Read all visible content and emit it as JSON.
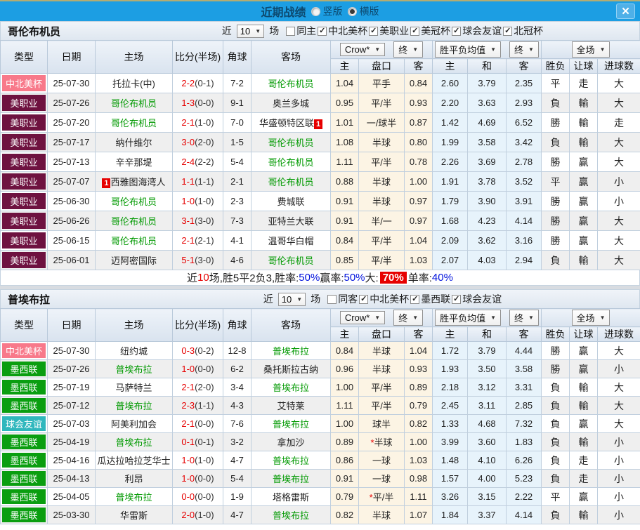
{
  "icons": {
    "close": "✕",
    "dropdown_arrow": "▼",
    "check": "✓"
  },
  "colors": {
    "accent_blue": "#1c9ee3",
    "win_red": "#e60000",
    "lose_green": "#008800",
    "draw_blue": "#0012dd",
    "type": {
      "中北美杯": "#f8798a",
      "美职业": "#6e1240",
      "墨西联": "#0a9e10",
      "球会友谊": "#2fb7bd"
    }
  },
  "titlebar": {
    "title": "近期战绩",
    "radio_vertical": "竖版",
    "radio_horizontal": "横版",
    "selected": "横版"
  },
  "table_header": {
    "cols": [
      "类型",
      "日期",
      "主场",
      "比分(半场)",
      "角球",
      "客场"
    ],
    "sub": [
      "主",
      "盘口",
      "客",
      "主",
      "和",
      "客",
      "胜负",
      "让球",
      "进球数"
    ],
    "dd_company": "Crow*",
    "dd_final": "终",
    "dd_avg": "胜平负均值",
    "dd_final2": "终",
    "dd_scope": "全场"
  },
  "sections": [
    {
      "team": "哥伦布机员",
      "filter": {
        "prefix": "近",
        "count": "10",
        "suffix": "场",
        "same": "同主",
        "leagues": [
          "中北美杯",
          "美职业",
          "美冠杯",
          "球会友谊",
          "北冠杯"
        ]
      },
      "rows": [
        {
          "type": "中北美杯",
          "date": "25-07-30",
          "home": "托拉卡(中)",
          "home_green": false,
          "home_badge": null,
          "ft": "2-2",
          "ht": "(0-1)",
          "corner": "7-2",
          "away": "哥伦布机员",
          "away_green": true,
          "away_badge": null,
          "odds": [
            "1.04",
            "平手",
            "0.84"
          ],
          "avg": [
            "2.60",
            "3.79",
            "2.35"
          ],
          "res": [
            "平",
            "走",
            "大"
          ],
          "rc": [
            "b",
            "b",
            "r"
          ]
        },
        {
          "type": "美职业",
          "date": "25-07-26",
          "home": "哥伦布机员",
          "home_green": true,
          "home_badge": null,
          "ft": "1-3",
          "ht": "(0-0)",
          "corner": "9-1",
          "away": "奥兰多城",
          "away_green": false,
          "away_badge": null,
          "odds": [
            "0.95",
            "平/半",
            "0.93"
          ],
          "avg": [
            "2.20",
            "3.63",
            "2.93"
          ],
          "res": [
            "負",
            "輸",
            "大"
          ],
          "rc": [
            "g",
            "g",
            "r"
          ]
        },
        {
          "type": "美职业",
          "date": "25-07-20",
          "home": "哥伦布机员",
          "home_green": true,
          "home_badge": null,
          "ft": "2-1",
          "ht": "(1-0)",
          "corner": "7-0",
          "away": "华盛顿特区联",
          "away_green": false,
          "away_badge": "1",
          "odds": [
            "1.01",
            "一/球半",
            "0.87"
          ],
          "avg": [
            "1.42",
            "4.69",
            "6.52"
          ],
          "res": [
            "勝",
            "輸",
            "走"
          ],
          "rc": [
            "r",
            "g",
            "b"
          ]
        },
        {
          "type": "美职业",
          "date": "25-07-17",
          "home": "纳什维尔",
          "home_green": false,
          "home_badge": null,
          "ft": "3-0",
          "ht": "(2-0)",
          "corner": "1-5",
          "away": "哥伦布机员",
          "away_green": true,
          "away_badge": null,
          "odds": [
            "1.08",
            "半球",
            "0.80"
          ],
          "avg": [
            "1.99",
            "3.58",
            "3.42"
          ],
          "res": [
            "負",
            "輸",
            "大"
          ],
          "rc": [
            "g",
            "g",
            "r"
          ]
        },
        {
          "type": "美职业",
          "date": "25-07-13",
          "home": "辛辛那堤",
          "home_green": false,
          "home_badge": null,
          "ft": "2-4",
          "ht": "(2-2)",
          "corner": "5-4",
          "away": "哥伦布机员",
          "away_green": true,
          "away_badge": null,
          "odds": [
            "1.11",
            "平/半",
            "0.78"
          ],
          "avg": [
            "2.26",
            "3.69",
            "2.78"
          ],
          "res": [
            "勝",
            "贏",
            "大"
          ],
          "rc": [
            "r",
            "r",
            "r"
          ]
        },
        {
          "type": "美职业",
          "date": "25-07-07",
          "home": "西雅图海湾人",
          "home_green": false,
          "home_badge": "1",
          "ft": "1-1",
          "ht": "(1-1)",
          "corner": "2-1",
          "away": "哥伦布机员",
          "away_green": true,
          "away_badge": null,
          "odds": [
            "0.88",
            "半球",
            "1.00"
          ],
          "avg": [
            "1.91",
            "3.78",
            "3.52"
          ],
          "res": [
            "平",
            "贏",
            "小"
          ],
          "rc": [
            "b",
            "r",
            "g"
          ]
        },
        {
          "type": "美职业",
          "date": "25-06-30",
          "home": "哥伦布机员",
          "home_green": true,
          "home_badge": null,
          "ft": "1-0",
          "ht": "(1-0)",
          "corner": "2-3",
          "away": "费城联",
          "away_green": false,
          "away_badge": null,
          "odds": [
            "0.91",
            "半球",
            "0.97"
          ],
          "avg": [
            "1.79",
            "3.90",
            "3.91"
          ],
          "res": [
            "勝",
            "贏",
            "小"
          ],
          "rc": [
            "r",
            "r",
            "g"
          ]
        },
        {
          "type": "美职业",
          "date": "25-06-26",
          "home": "哥伦布机员",
          "home_green": true,
          "home_badge": null,
          "ft": "3-1",
          "ht": "(3-0)",
          "corner": "7-3",
          "away": "亚特兰大联",
          "away_green": false,
          "away_badge": null,
          "odds": [
            "0.91",
            "半/一",
            "0.97"
          ],
          "avg": [
            "1.68",
            "4.23",
            "4.14"
          ],
          "res": [
            "勝",
            "贏",
            "大"
          ],
          "rc": [
            "r",
            "r",
            "r"
          ]
        },
        {
          "type": "美职业",
          "date": "25-06-15",
          "home": "哥伦布机员",
          "home_green": true,
          "home_badge": null,
          "ft": "2-1",
          "ht": "(2-1)",
          "corner": "4-1",
          "away": "温哥华白帽",
          "away_green": false,
          "away_badge": null,
          "odds": [
            "0.84",
            "平/半",
            "1.04"
          ],
          "avg": [
            "2.09",
            "3.62",
            "3.16"
          ],
          "res": [
            "勝",
            "贏",
            "大"
          ],
          "rc": [
            "r",
            "r",
            "r"
          ]
        },
        {
          "type": "美职业",
          "date": "25-06-01",
          "home": "迈阿密国际",
          "home_green": false,
          "home_badge": null,
          "ft": "5-1",
          "ht": "(3-0)",
          "corner": "4-6",
          "away": "哥伦布机员",
          "away_green": true,
          "away_badge": null,
          "odds": [
            "0.85",
            "平/半",
            "1.03"
          ],
          "avg": [
            "2.07",
            "4.03",
            "2.94"
          ],
          "res": [
            "負",
            "輸",
            "大"
          ],
          "rc": [
            "g",
            "g",
            "r"
          ]
        }
      ],
      "summary": [
        [
          "近",
          "k"
        ],
        [
          "10",
          "r"
        ],
        [
          "场,胜5平2负3, ",
          "k"
        ],
        [
          "胜率:",
          "k"
        ],
        [
          "50%",
          "b"
        ],
        [
          " 赢率:",
          "k"
        ],
        [
          "50%",
          "b"
        ],
        [
          " 大:",
          "k"
        ],
        [
          "70%",
          "hl"
        ],
        [
          " 单率:",
          "k"
        ],
        [
          "40%",
          "b"
        ]
      ]
    },
    {
      "team": "普埃布拉",
      "filter": {
        "prefix": "近",
        "count": "10",
        "suffix": "场",
        "same": "同客",
        "leagues": [
          "中北美杯",
          "墨西联",
          "球会友谊"
        ]
      },
      "rows": [
        {
          "type": "中北美杯",
          "date": "25-07-30",
          "home": "纽约城",
          "home_green": false,
          "home_badge": null,
          "ft": "0-3",
          "ht": "(0-2)",
          "corner": "12-8",
          "away": "普埃布拉",
          "away_green": true,
          "away_badge": null,
          "odds": [
            "0.84",
            "半球",
            "1.04"
          ],
          "avg": [
            "1.72",
            "3.79",
            "4.44"
          ],
          "res": [
            "勝",
            "贏",
            "大"
          ],
          "rc": [
            "r",
            "r",
            "r"
          ]
        },
        {
          "type": "墨西联",
          "date": "25-07-26",
          "home": "普埃布拉",
          "home_green": true,
          "home_badge": null,
          "ft": "1-0",
          "ht": "(0-0)",
          "corner": "6-2",
          "away": "桑托斯拉古纳",
          "away_green": false,
          "away_badge": null,
          "odds": [
            "0.96",
            "半球",
            "0.93"
          ],
          "avg": [
            "1.93",
            "3.50",
            "3.58"
          ],
          "res": [
            "勝",
            "贏",
            "小"
          ],
          "rc": [
            "r",
            "r",
            "g"
          ]
        },
        {
          "type": "墨西联",
          "date": "25-07-19",
          "home": "马萨特兰",
          "home_green": false,
          "home_badge": null,
          "ft": "2-1",
          "ht": "(2-0)",
          "corner": "3-4",
          "away": "普埃布拉",
          "away_green": true,
          "away_badge": null,
          "odds": [
            "1.00",
            "平/半",
            "0.89"
          ],
          "avg": [
            "2.18",
            "3.12",
            "3.31"
          ],
          "res": [
            "負",
            "輸",
            "大"
          ],
          "rc": [
            "g",
            "g",
            "r"
          ]
        },
        {
          "type": "墨西联",
          "date": "25-07-12",
          "home": "普埃布拉",
          "home_green": true,
          "home_badge": null,
          "ft": "2-3",
          "ht": "(1-1)",
          "corner": "4-3",
          "away": "艾特莱",
          "away_green": false,
          "away_badge": null,
          "odds": [
            "1.11",
            "平/半",
            "0.79"
          ],
          "avg": [
            "2.45",
            "3.11",
            "2.85"
          ],
          "res": [
            "負",
            "輸",
            "大"
          ],
          "rc": [
            "g",
            "g",
            "r"
          ]
        },
        {
          "type": "球会友谊",
          "date": "25-07-03",
          "home": "阿美利加会",
          "home_green": false,
          "home_badge": null,
          "ft": "2-1",
          "ht": "(0-0)",
          "corner": "7-6",
          "away": "普埃布拉",
          "away_green": true,
          "away_badge": null,
          "odds": [
            "1.00",
            "球半",
            "0.82"
          ],
          "avg": [
            "1.33",
            "4.68",
            "7.32"
          ],
          "res": [
            "負",
            "贏",
            "大"
          ],
          "rc": [
            "g",
            "r",
            "r"
          ]
        },
        {
          "type": "墨西联",
          "date": "25-04-19",
          "home": "普埃布拉",
          "home_green": true,
          "home_badge": null,
          "ft": "0-1",
          "ht": "(0-1)",
          "corner": "3-2",
          "away": "拿加沙",
          "away_green": false,
          "away_badge": null,
          "odds": [
            "0.89",
            "*半球",
            "1.00"
          ],
          "avg": [
            "3.99",
            "3.60",
            "1.83"
          ],
          "res": [
            "負",
            "輸",
            "小"
          ],
          "rc": [
            "g",
            "g",
            "g"
          ]
        },
        {
          "type": "墨西联",
          "date": "25-04-16",
          "home": "瓜达拉哈拉芝华士",
          "home_green": false,
          "home_badge": null,
          "ft": "1-0",
          "ht": "(1-0)",
          "corner": "4-7",
          "away": "普埃布拉",
          "away_green": true,
          "away_badge": null,
          "odds": [
            "0.86",
            "一球",
            "1.03"
          ],
          "avg": [
            "1.48",
            "4.10",
            "6.26"
          ],
          "res": [
            "負",
            "走",
            "小"
          ],
          "rc": [
            "g",
            "b",
            "g"
          ]
        },
        {
          "type": "墨西联",
          "date": "25-04-13",
          "home": "利昂",
          "home_green": false,
          "home_badge": null,
          "ft": "1-0",
          "ht": "(0-0)",
          "corner": "5-4",
          "away": "普埃布拉",
          "away_green": true,
          "away_badge": null,
          "odds": [
            "0.91",
            "一球",
            "0.98"
          ],
          "avg": [
            "1.57",
            "4.00",
            "5.23"
          ],
          "res": [
            "負",
            "走",
            "小"
          ],
          "rc": [
            "g",
            "b",
            "g"
          ]
        },
        {
          "type": "墨西联",
          "date": "25-04-05",
          "home": "普埃布拉",
          "home_green": true,
          "home_badge": null,
          "ft": "0-0",
          "ht": "(0-0)",
          "corner": "1-9",
          "away": "塔格雷斯",
          "away_green": false,
          "away_badge": null,
          "odds": [
            "0.79",
            "*平/半",
            "1.11"
          ],
          "avg": [
            "3.26",
            "3.15",
            "2.22"
          ],
          "res": [
            "平",
            "贏",
            "小"
          ],
          "rc": [
            "b",
            "r",
            "g"
          ]
        },
        {
          "type": "墨西联",
          "date": "25-03-30",
          "home": "华雷斯",
          "home_green": false,
          "home_badge": null,
          "ft": "2-0",
          "ht": "(1-0)",
          "corner": "4-7",
          "away": "普埃布拉",
          "away_green": true,
          "away_badge": null,
          "odds": [
            "0.82",
            "半球",
            "1.07"
          ],
          "avg": [
            "1.84",
            "3.37",
            "4.14"
          ],
          "res": [
            "負",
            "輸",
            "小"
          ],
          "rc": [
            "g",
            "g",
            "g"
          ]
        }
      ]
    }
  ]
}
